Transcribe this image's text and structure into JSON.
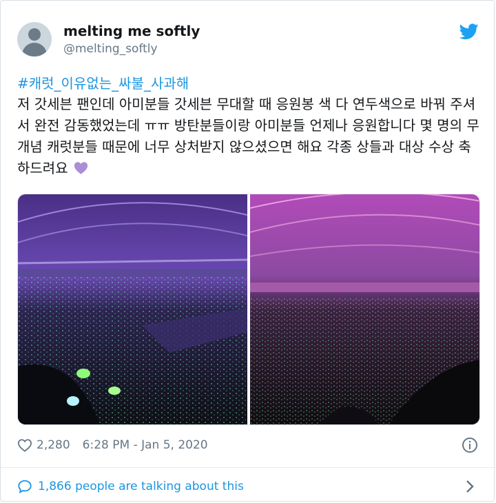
{
  "user": {
    "display_name": "melting me softly",
    "handle": "@melting_softly",
    "avatar_icon": "default-avatar"
  },
  "platform_icon": "twitter-bird-icon",
  "tweet": {
    "hashtag": "#캐럿_이유없는_싸불_사과해",
    "text": "저 갓세븐 팬인데 아미분들 갓세븐 무대할 때 응원봉 색 다 연두색으로 바꿔 주셔서 완전 감동했었는데 ㅠㅠ 방탄분들이랑 아미분들 언제나 응원합니다 몇 명의 무개념 캐럿분들 때문에 너무 상처받지 않으셨으면 해요 각종 상들과 대상 수상 축하드려요",
    "emoji": "purple-heart",
    "media": [
      "arena-photo-purple-lights",
      "arena-photo-pink-lights"
    ]
  },
  "meta": {
    "likes": "2,280",
    "time": "6:28 PM - Jan 5, 2020"
  },
  "footer": {
    "talking": "1,866 people are talking about this"
  },
  "colors": {
    "link": "#1b95e0",
    "text": "#14171a",
    "muted": "#657786",
    "twitter_blue": "#1da1f2"
  }
}
